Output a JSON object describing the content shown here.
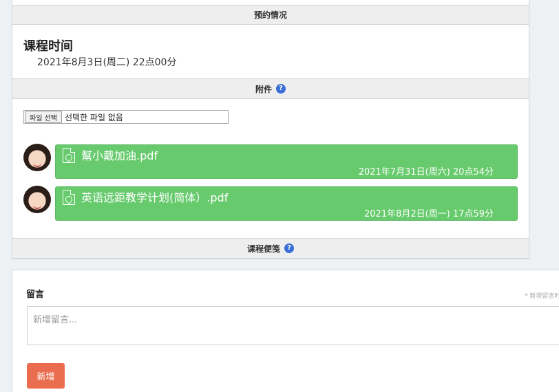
{
  "booking": {
    "section_title": "预约情况",
    "course_time_label": "课程时间",
    "course_time_value": "2021年8月3日(周二) 22点00分"
  },
  "attachments": {
    "section_title": "附件",
    "help": "?",
    "file_button": "파일 선택",
    "file_status": "선택한 파일 없음",
    "items": [
      {
        "name": "幫小戴加油.pdf",
        "date": "2021年7月31日(周六) 20点54分"
      },
      {
        "name": "英语远距教学计划(简体）.pdf",
        "date": "2021年8月2日(周一) 17点59分"
      }
    ]
  },
  "notes": {
    "section_title": "课程便笺",
    "help": "?"
  },
  "message": {
    "label": "留言",
    "hint": "* 新增留言时",
    "placeholder": "新增留言...",
    "submit_label": "新增"
  },
  "colors": {
    "attachment_bg": "#67cb6d",
    "help_icon": "#3b6fd8",
    "submit_button": "#ea6d4f"
  }
}
